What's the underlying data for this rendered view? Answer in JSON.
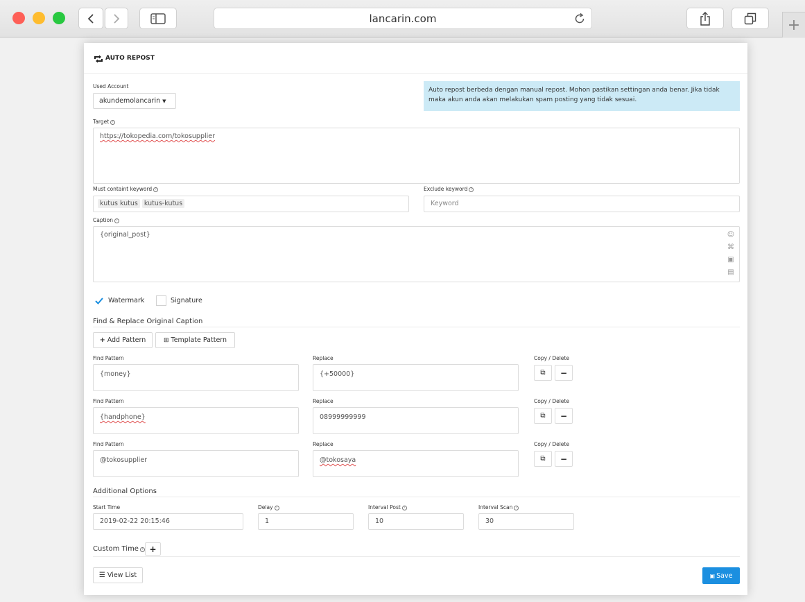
{
  "browser": {
    "url": "lancarin.com"
  },
  "card": {
    "title": "AUTO REPOST",
    "used_account": {
      "label": "Used Account",
      "value": "akundemolancarin"
    },
    "notice": "Auto repost berbeda dengan manual repost. Mohon pastikan settingan anda benar. Jika tidak maka akun anda akan melakukan spam posting yang tidak sesuai.",
    "target": {
      "label": "Target",
      "value": "https://tokopedia.com/tokosupplier"
    },
    "must_keyword": {
      "label": "Must containt keyword",
      "tags": [
        "kutus kutus",
        "kutus-kutus"
      ]
    },
    "exclude_keyword": {
      "label": "Exclude keyword",
      "placeholder": "Keyword"
    },
    "caption": {
      "label": "Caption",
      "value": "{original_post}"
    },
    "checks": {
      "watermark": "Watermark",
      "signature": "Signature"
    },
    "find_replace": {
      "title": "Find & Replace Original Caption",
      "add_pattern": "Add Pattern",
      "template_pattern": "Template Pattern",
      "find_label": "Find Pattern",
      "replace_label": "Replace",
      "action_label": "Copy / Delete",
      "rows": [
        {
          "find": "{money}",
          "replace": "{+50000}"
        },
        {
          "find": "{handphone}",
          "replace": "08999999999"
        },
        {
          "find": "@tokosupplier",
          "replace": "@tokosaya"
        }
      ]
    },
    "additional": {
      "title": "Additional Options",
      "start_time_label": "Start Time",
      "start_time": "2019-02-22 20:15:46",
      "delay_label": "Delay",
      "delay": "1",
      "interval_post_label": "Interval Post",
      "interval_post": "10",
      "interval_scan_label": "Interval Scan",
      "interval_scan": "30"
    },
    "custom_time_label": "Custom Time",
    "view_list": "View List",
    "save": "Save"
  },
  "colors": {
    "save_button": "#1b8fe0",
    "notice_bg": "#cceaf6",
    "close": "#fe5f57",
    "minimize": "#febc2e",
    "zoom": "#28c840"
  }
}
